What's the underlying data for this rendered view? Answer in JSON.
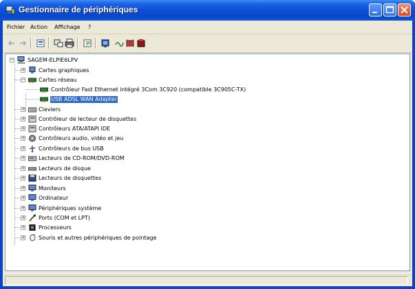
{
  "window": {
    "title": "Gestionnaire de périphériques",
    "colors": {
      "titlebar": "#0a4fd6",
      "selection": "#316ac5",
      "face": "#ece9d8"
    }
  },
  "menubar": {
    "items": [
      {
        "label": "Fichier"
      },
      {
        "label": "Action"
      },
      {
        "label": "Affichage"
      },
      {
        "label": "?"
      }
    ]
  },
  "toolbar": {
    "icons": [
      "back-arrow-icon",
      "forward-arrow-icon",
      "properties-icon",
      "print-icon",
      "scan-icon",
      "update-driver-icon",
      "uninstall-icon",
      "disable-icon"
    ]
  },
  "tree": {
    "root": {
      "label": "SAGEM-ELPIE6LPV",
      "icon": "computer-icon"
    },
    "nodes": [
      {
        "label": "Cartes graphiques",
        "icon": "display-adapter-icon",
        "expander": "+"
      },
      {
        "label": "Cartes réseau",
        "icon": "network-card-icon",
        "expander": "−",
        "children": [
          {
            "label": "Contrôleur Fast Ethernet intégré 3Com 3C920 (compatible 3C905C-TX)",
            "icon": "network-card-icon"
          },
          {
            "label": "USB ADSL WAN Adapter",
            "icon": "network-card-icon",
            "selected": true
          }
        ]
      },
      {
        "label": "Claviers",
        "icon": "keyboard-icon",
        "expander": "+"
      },
      {
        "label": "Contrôleur de lecteur de disquettes",
        "icon": "controller-icon",
        "expander": "+"
      },
      {
        "label": "Contrôleurs ATA/ATAPI IDE",
        "icon": "controller-icon",
        "expander": "+"
      },
      {
        "label": "Contrôleurs audio, vidéo et jeu",
        "icon": "audio-icon",
        "expander": "+"
      },
      {
        "label": "Contrôleurs de bus USB",
        "icon": "usb-icon",
        "expander": "+"
      },
      {
        "label": "Lecteurs de CD-ROM/DVD-ROM",
        "icon": "cdrom-icon",
        "expander": "+"
      },
      {
        "label": "Lecteurs de disque",
        "icon": "disk-icon",
        "expander": "+"
      },
      {
        "label": "Lecteurs de disquettes",
        "icon": "floppy-icon",
        "expander": "+"
      },
      {
        "label": "Moniteurs",
        "icon": "monitor-icon",
        "expander": "+"
      },
      {
        "label": "Ordinateur",
        "icon": "computer-icon",
        "expander": "+"
      },
      {
        "label": "Périphériques système",
        "icon": "system-device-icon",
        "expander": "+"
      },
      {
        "label": "Ports (COM et LPT)",
        "icon": "port-icon",
        "expander": "+"
      },
      {
        "label": "Processeurs",
        "icon": "processor-icon",
        "expander": "+"
      },
      {
        "label": "Souris et autres périphériques de pointage",
        "icon": "mouse-icon",
        "expander": "+"
      }
    ]
  },
  "statusbar": {
    "text": ""
  }
}
